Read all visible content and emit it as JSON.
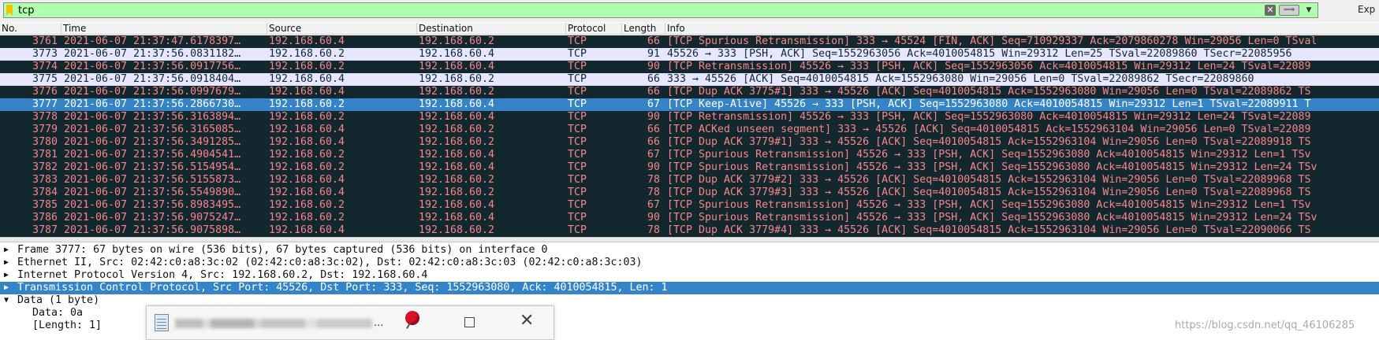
{
  "filter": {
    "value": "tcp",
    "expression_label": "Exp"
  },
  "columns": [
    "No.",
    "Time",
    "Source",
    "Destination",
    "Protocol",
    "Length",
    "Info"
  ],
  "packets": [
    {
      "no": "3761",
      "time": "2021-06-07 21:37:47.6178397…",
      "src": "192.168.60.4",
      "dst": "192.168.60.2",
      "proto": "TCP",
      "len": "66",
      "info": "[TCP Spurious Retransmission] 333 → 45524 [FIN, ACK] Seq=710929337 Ack=2079860278 Win=29056 Len=0 TSval",
      "style": "err"
    },
    {
      "no": "3773",
      "time": "2021-06-07 21:37:56.0831182…",
      "src": "192.168.60.2",
      "dst": "192.168.60.4",
      "proto": "TCP",
      "len": "91",
      "info": "45526 → 333 [PSH, ACK] Seq=1552963056 Ack=4010054815 Win=29312 Len=25 TSval=22089860 TSecr=22085956",
      "style": "alt"
    },
    {
      "no": "3774",
      "time": "2021-06-07 21:37:56.0917756…",
      "src": "192.168.60.2",
      "dst": "192.168.60.4",
      "proto": "TCP",
      "len": "90",
      "info": "[TCP Retransmission] 45526 → 333 [PSH, ACK] Seq=1552963056 Ack=4010054815 Win=29312 Len=24 TSval=22089",
      "style": "err"
    },
    {
      "no": "3775",
      "time": "2021-06-07 21:37:56.0918404…",
      "src": "192.168.60.4",
      "dst": "192.168.60.2",
      "proto": "TCP",
      "len": "66",
      "info": "333 → 45526 [ACK] Seq=4010054815 Ack=1552963080 Win=29056 Len=0 TSval=22089862 TSecr=22089860",
      "style": "alt"
    },
    {
      "no": "3776",
      "time": "2021-06-07 21:37:56.0997679…",
      "src": "192.168.60.4",
      "dst": "192.168.60.2",
      "proto": "TCP",
      "len": "66",
      "info": "[TCP Dup ACK 3775#1] 333 → 45526 [ACK] Seq=4010054815 Ack=1552963080 Win=29056 Len=0 TSval=22089862 TS",
      "style": "err"
    },
    {
      "no": "3777",
      "time": "2021-06-07 21:37:56.2866730…",
      "src": "192.168.60.2",
      "dst": "192.168.60.4",
      "proto": "TCP",
      "len": "67",
      "info": "[TCP Keep-Alive] 45526 → 333 [PSH, ACK] Seq=1552963080 Ack=4010054815 Win=29312 Len=1 TSval=22089911 T",
      "style": "sel"
    },
    {
      "no": "3778",
      "time": "2021-06-07 21:37:56.3163894…",
      "src": "192.168.60.2",
      "dst": "192.168.60.4",
      "proto": "TCP",
      "len": "90",
      "info": "[TCP Retransmission] 45526 → 333 [PSH, ACK] Seq=1552963080 Ack=4010054815 Win=29312 Len=24 TSval=22089",
      "style": "err"
    },
    {
      "no": "3779",
      "time": "2021-06-07 21:37:56.3165085…",
      "src": "192.168.60.4",
      "dst": "192.168.60.2",
      "proto": "TCP",
      "len": "66",
      "info": "[TCP ACKed unseen segment] 333 → 45526 [ACK] Seq=4010054815 Ack=1552963104 Win=29056 Len=0 TSval=22089",
      "style": "err"
    },
    {
      "no": "3780",
      "time": "2021-06-07 21:37:56.3491285…",
      "src": "192.168.60.4",
      "dst": "192.168.60.2",
      "proto": "TCP",
      "len": "66",
      "info": "[TCP Dup ACK 3779#1] 333 → 45526 [ACK] Seq=4010054815 Ack=1552963104 Win=29056 Len=0 TSval=22089918 TS",
      "style": "err"
    },
    {
      "no": "3781",
      "time": "2021-06-07 21:37:56.4904541…",
      "src": "192.168.60.2",
      "dst": "192.168.60.4",
      "proto": "TCP",
      "len": "67",
      "info": "[TCP Spurious Retransmission] 45526 → 333 [PSH, ACK] Seq=1552963080 Ack=4010054815 Win=29312 Len=1 TSv",
      "style": "err"
    },
    {
      "no": "3782",
      "time": "2021-06-07 21:37:56.5154954…",
      "src": "192.168.60.2",
      "dst": "192.168.60.4",
      "proto": "TCP",
      "len": "90",
      "info": "[TCP Spurious Retransmission] 45526 → 333 [PSH, ACK] Seq=1552963080 Ack=4010054815 Win=29312 Len=24 TSv",
      "style": "err"
    },
    {
      "no": "3783",
      "time": "2021-06-07 21:37:56.5155873…",
      "src": "192.168.60.4",
      "dst": "192.168.60.2",
      "proto": "TCP",
      "len": "78",
      "info": "[TCP Dup ACK 3779#2] 333 → 45526 [ACK] Seq=4010054815 Ack=1552963104 Win=29056 Len=0 TSval=22089968 TS",
      "style": "err"
    },
    {
      "no": "3784",
      "time": "2021-06-07 21:37:56.5549890…",
      "src": "192.168.60.4",
      "dst": "192.168.60.2",
      "proto": "TCP",
      "len": "78",
      "info": "[TCP Dup ACK 3779#3] 333 → 45526 [ACK] Seq=4010054815 Ack=1552963104 Win=29056 Len=0 TSval=22089968 TS",
      "style": "err"
    },
    {
      "no": "3785",
      "time": "2021-06-07 21:37:56.8983495…",
      "src": "192.168.60.2",
      "dst": "192.168.60.4",
      "proto": "TCP",
      "len": "67",
      "info": "[TCP Spurious Retransmission] 45526 → 333 [PSH, ACK] Seq=1552963080 Ack=4010054815 Win=29312 Len=1 TSv",
      "style": "err"
    },
    {
      "no": "3786",
      "time": "2021-06-07 21:37:56.9075247…",
      "src": "192.168.60.2",
      "dst": "192.168.60.4",
      "proto": "TCP",
      "len": "90",
      "info": "[TCP Spurious Retransmission] 45526 → 333 [PSH, ACK] Seq=1552963080 Ack=4010054815 Win=29312 Len=24 TSv",
      "style": "err"
    },
    {
      "no": "3787",
      "time": "2021-06-07 21:37:56.9075898…",
      "src": "192.168.60.4",
      "dst": "192.168.60.2",
      "proto": "TCP",
      "len": "78",
      "info": "[TCP Dup ACK 3779#4] 333 → 45526 [ACK] Seq=4010054815 Ack=1552963104 Win=29056 Len=0 TSval=22090066 TS",
      "style": "err"
    }
  ],
  "details": {
    "frame": "Frame 3777: 67 bytes on wire (536 bits), 67 bytes captured (536 bits) on interface 0",
    "ethernet": "Ethernet II, Src: 02:42:c0:a8:3c:02 (02:42:c0:a8:3c:02), Dst: 02:42:c0:a8:3c:03 (02:42:c0:a8:3c:03)",
    "ip": "Internet Protocol Version 4, Src: 192.168.60.2, Dst: 192.168.60.4",
    "tcp": "Transmission Control Protocol, Src Port: 45526, Dst Port: 333, Seq: 1552963080, Ack: 4010054815, Len: 1",
    "data": "Data (1 byte)",
    "data_value": "Data: 0a",
    "data_length": "[Length: 1]"
  },
  "popup": {
    "ellipsis": "..."
  },
  "watermark": "https://blog.csdn.net/qq_46106285",
  "colors": {
    "filter_valid": "#afffaf",
    "row_error_bg": "#12272e",
    "row_error_fg": "#f78787",
    "row_alt_bg": "#e7e6ff",
    "selection": "#3584c8"
  }
}
